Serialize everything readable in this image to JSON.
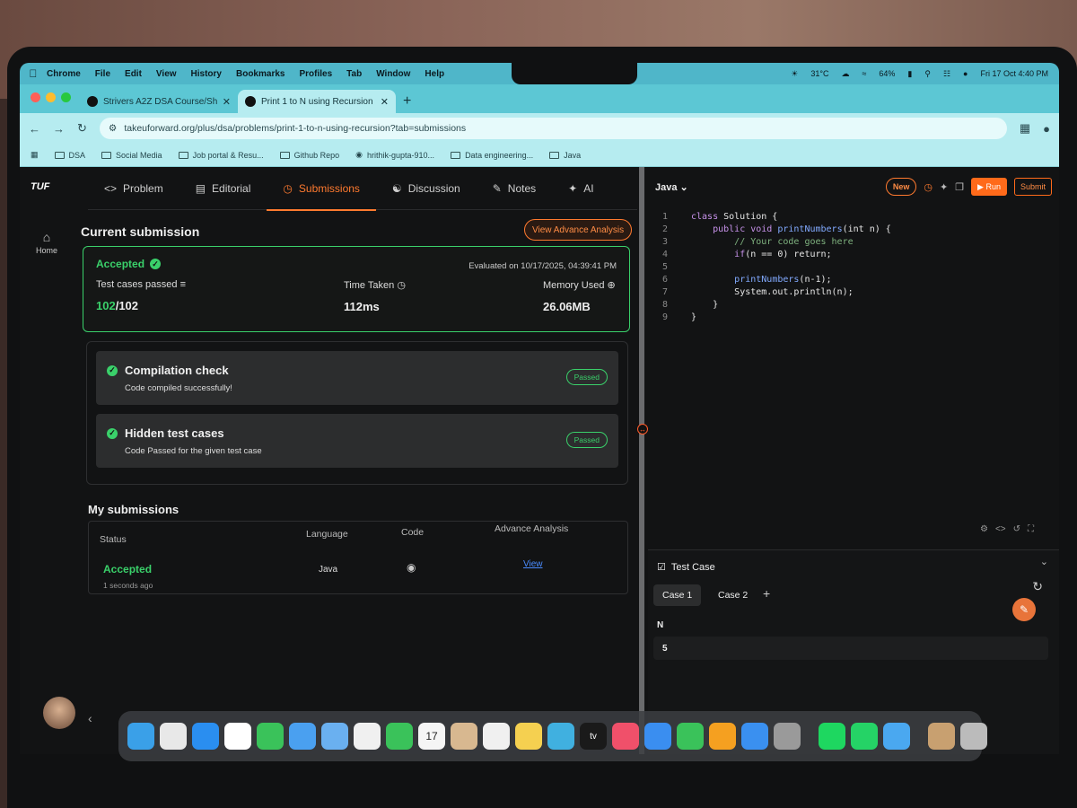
{
  "menubar": {
    "app": "Chrome",
    "items": [
      "File",
      "Edit",
      "View",
      "History",
      "Bookmarks",
      "Profiles",
      "Tab",
      "Window",
      "Help"
    ],
    "weather": "31°C",
    "battery": "64%",
    "datetime": "Fri 17 Oct  4:40 PM"
  },
  "tabs": [
    {
      "title": "Strivers A2Z DSA Course/She"
    },
    {
      "title": "Print 1 to N using Recursion"
    }
  ],
  "address": {
    "url": "takeuforward.org/plus/dsa/problems/print-1-to-n-using-recursion?tab=submissions"
  },
  "bookmarks": [
    "DSA",
    "Social Media",
    "Job portal & Resu...",
    "Github Repo",
    "hrithik-gupta-910...",
    "Data engineering...",
    "Java"
  ],
  "sidebar": {
    "logo": "TUF",
    "home_label": "Home"
  },
  "nav": {
    "problem": "Problem",
    "editorial": "Editorial",
    "submissions": "Submissions",
    "discussion": "Discussion",
    "notes": "Notes",
    "ai": "AI"
  },
  "current": {
    "title": "Current submission",
    "advance_btn": "View Advance Analysis",
    "status": "Accepted",
    "evaluated": "Evaluated on 10/17/2025, 04:39:41 PM",
    "tests_label": "Test cases passed",
    "tests_passed": "102",
    "tests_total": "/102",
    "time_label": "Time Taken",
    "time_value": "112ms",
    "memory_label": "Memory Used",
    "memory_value": "26.06MB"
  },
  "checks": [
    {
      "title": "Compilation check",
      "desc": "Code compiled successfully!",
      "badge": "Passed"
    },
    {
      "title": "Hidden test cases",
      "desc": "Code Passed for the given test case",
      "badge": "Passed"
    }
  ],
  "my_submissions": {
    "title": "My submissions",
    "headers": {
      "status": "Status",
      "language": "Language",
      "code": "Code",
      "advance": "Advance Analysis"
    },
    "row": {
      "status": "Accepted",
      "ago": "1 seconds ago",
      "language": "Java",
      "advance": "View"
    }
  },
  "editor": {
    "language": "Java",
    "new_label": "New",
    "run_label": "Run",
    "submit_label": "Submit",
    "lines": [
      {
        "n": "1",
        "indent": "",
        "kw": "class ",
        "fn": "",
        "tx": "Solution {"
      },
      {
        "n": "2",
        "indent": "    ",
        "kw": "public void ",
        "fn": "printNumbers",
        "tx": "(int n) {"
      },
      {
        "n": "3",
        "indent": "        ",
        "kw": "",
        "fn": "",
        "tx": "",
        "cm": "// Your code goes here"
      },
      {
        "n": "4",
        "indent": "        ",
        "kw": "if",
        "fn": "",
        "tx": "(n == 0) return;"
      },
      {
        "n": "5",
        "indent": "",
        "kw": "",
        "fn": "",
        "tx": ""
      },
      {
        "n": "6",
        "indent": "        ",
        "kw": "",
        "fn": "printNumbers",
        "tx": "(n-1);"
      },
      {
        "n": "7",
        "indent": "        ",
        "kw": "",
        "fn": "",
        "tx": "System.out.println(n);"
      },
      {
        "n": "8",
        "indent": "    ",
        "kw": "",
        "fn": "",
        "tx": "}"
      },
      {
        "n": "9",
        "indent": "",
        "kw": "",
        "fn": "",
        "tx": "}"
      }
    ]
  },
  "testcase": {
    "title": "Test Case",
    "case1": "Case 1",
    "case2": "Case 2",
    "add": "+",
    "input_label": "N",
    "input_value": "5"
  },
  "dock": {
    "calendar_day": "17",
    "tv_label": "tv",
    "icon_colors": [
      "#3aa0e8",
      "#e8e8e8",
      "#2a8ef0",
      "#ffffff",
      "#3ac25a",
      "#4aa0f0",
      "#6ab0f0",
      "#f0f0f0",
      "#3ac25a",
      "#f5f5f5",
      "#d8b890",
      "#f0f0f0",
      "#f5d050",
      "#40b0e0",
      "#1a1a1a",
      "#f0506a",
      "#3a8ef0",
      "#3ac25a",
      "#f5a020",
      "#3a90f0",
      "#9a9a9a",
      "#1ed760",
      "#25d366",
      "#4aa8f0",
      "#c8a070",
      "#bbbbbb"
    ]
  }
}
